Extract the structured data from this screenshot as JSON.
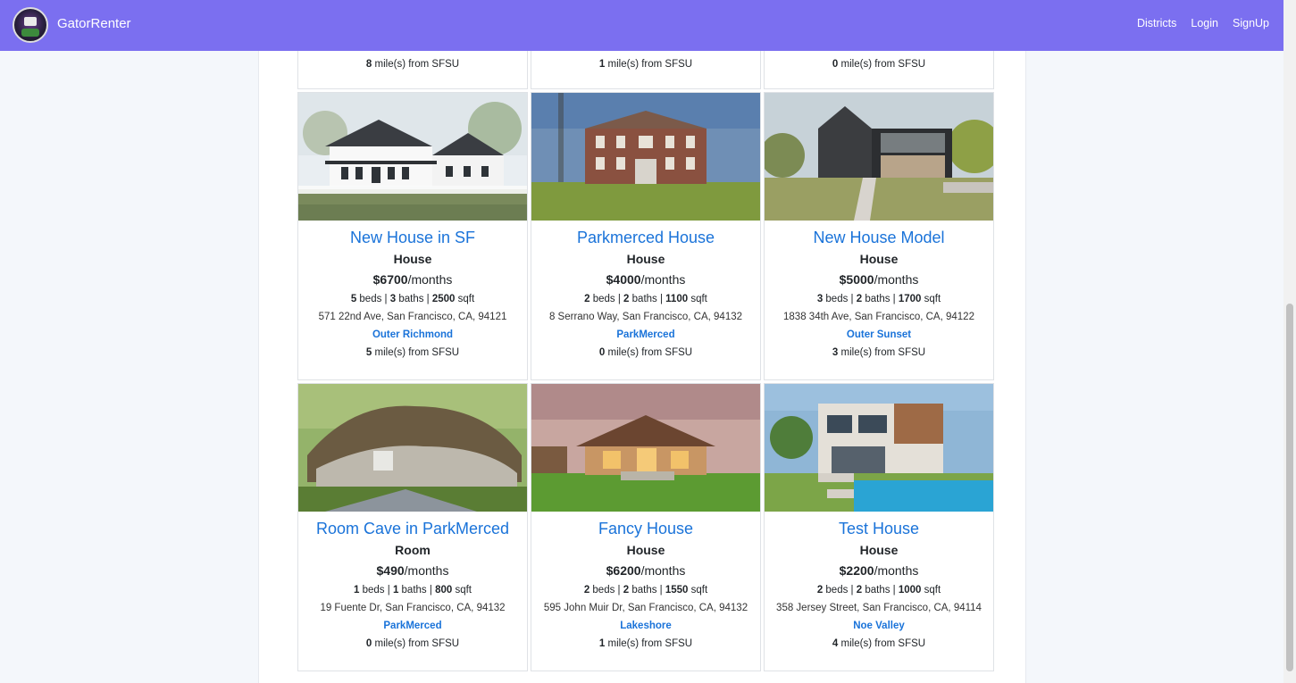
{
  "nav": {
    "brand": "GatorRenter",
    "links": [
      "Districts",
      "Login",
      "SignUp"
    ]
  },
  "top_row_miles": [
    {
      "n": "8",
      "t": " mile(s) from SFSU"
    },
    {
      "n": "1",
      "t": " mile(s) from SFSU"
    },
    {
      "n": "0",
      "t": " mile(s) from SFSU"
    }
  ],
  "listings": [
    {
      "title": "New House in SF",
      "type": "House",
      "price": "$6700",
      "per": "/months",
      "beds": "5",
      "baths": "3",
      "sqft": "2500",
      "address": "571 22nd Ave, San Francisco, CA, 94121",
      "district": "Outer Richmond",
      "miles": "5",
      "photo": "farmhouse"
    },
    {
      "title": "Parkmerced House",
      "type": "House",
      "price": "$4000",
      "per": "/months",
      "beds": "2",
      "baths": "2",
      "sqft": "1100",
      "address": "8 Serrano Way, San Francisco, CA, 94132",
      "district": "ParkMerced",
      "miles": "0",
      "photo": "brick"
    },
    {
      "title": "New House Model",
      "type": "House",
      "price": "$5000",
      "per": "/months",
      "beds": "3",
      "baths": "2",
      "sqft": "1700",
      "address": "1838 34th Ave, San Francisco, CA, 94122",
      "district": "Outer Sunset",
      "miles": "3",
      "photo": "modern"
    },
    {
      "title": "Room Cave in ParkMerced",
      "type": "Room",
      "price": "$490",
      "per": "/months",
      "beds": "1",
      "baths": "1",
      "sqft": "800",
      "address": "19 Fuente Dr, San Francisco, CA, 94132",
      "district": "ParkMerced",
      "miles": "0",
      "photo": "cave"
    },
    {
      "title": "Fancy House",
      "type": "House",
      "price": "$6200",
      "per": "/months",
      "beds": "2",
      "baths": "2",
      "sqft": "1550",
      "address": "595 John Muir Dr, San Francisco, CA, 94132",
      "district": "Lakeshore",
      "miles": "1",
      "photo": "ranch"
    },
    {
      "title": "Test House",
      "type": "House",
      "price": "$2200",
      "per": "/months",
      "beds": "2",
      "baths": "2",
      "sqft": "1000",
      "address": "358 Jersey Street, San Francisco, CA, 94114",
      "district": "Noe Valley",
      "miles": "4",
      "photo": "pool"
    }
  ],
  "labels": {
    "beds": " beds | ",
    "baths": " baths | ",
    "sqft": " sqft",
    "miles_suffix": " mile(s) from SFSU"
  },
  "colors": {
    "navbar": "#7b6ff0",
    "link": "#1a73d9"
  }
}
